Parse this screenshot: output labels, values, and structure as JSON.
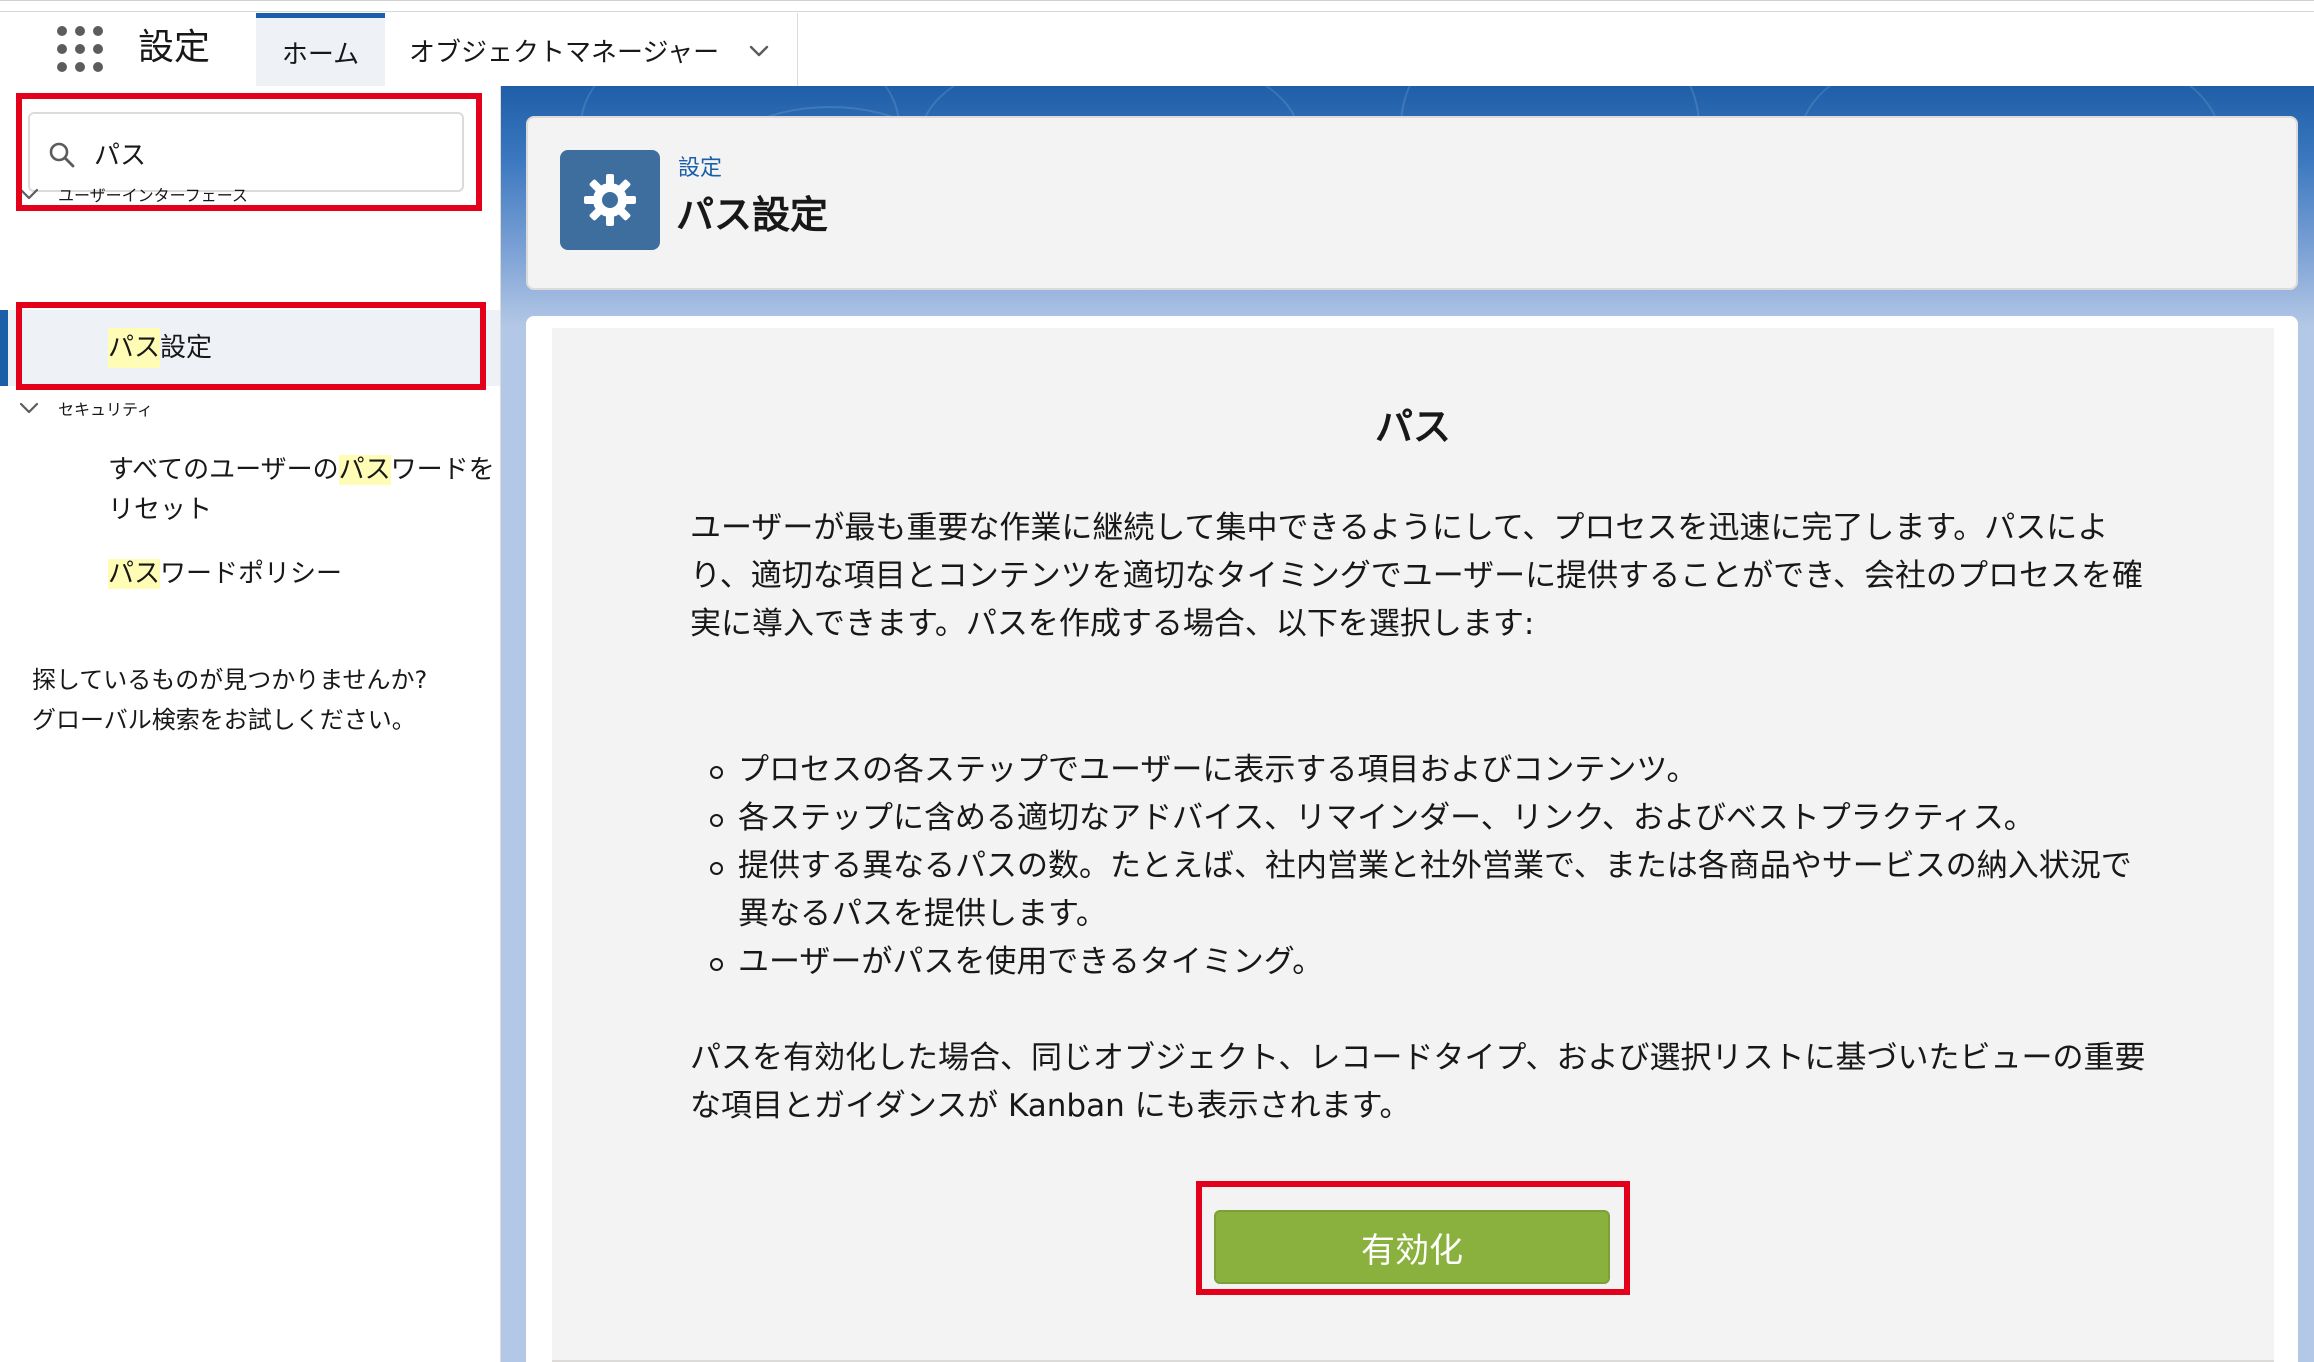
{
  "header": {
    "app_name": "設定",
    "tabs": [
      {
        "label": "ホーム",
        "active": true
      },
      {
        "label": "オブジェクトマネージャー",
        "active": false
      }
    ]
  },
  "sidebar": {
    "search": {
      "value": "パス",
      "placeholder": ""
    },
    "sections": [
      {
        "label": "ユーザーインターフェース",
        "items": [
          {
            "highlight": "パス",
            "rest": "設定",
            "selected": true
          }
        ]
      },
      {
        "label": "セキュリティ",
        "items": [
          {
            "prefix": "すべてのユーザーの",
            "highlight": "パス",
            "rest_line1": "ワードを",
            "rest_line2": "リセット"
          },
          {
            "highlight": "パス",
            "rest": "ワードポリシー"
          }
        ]
      }
    ],
    "help_line1": "探しているものが見つかりませんか?",
    "help_line2": "グローバル検索をお試しください。"
  },
  "page_header": {
    "breadcrumb": "設定",
    "title": "パス設定",
    "icon": "gear-icon"
  },
  "content": {
    "title": "パス",
    "description": "ユーザーが最も重要な作業に継続して集中できるようにして、プロセスを迅速に完了します。パスにより、適切な項目とコンテンツを適切なタイミングでユーザーに提供することができ、会社のプロセスを確実に導入できます。パスを作成する場合、以下を選択します:",
    "bullets": [
      "プロセスの各ステップでユーザーに表示する項目およびコンテンツ。",
      "各ステップに含める適切なアドバイス、リマインダー、リンク、およびベストプラクティス。",
      "提供する異なるパスの数。たとえば、社内営業と社外営業で、または各商品やサービスの納入状況で異なるパスを提供します。",
      "ユーザーがパスを使用できるタイミング。"
    ],
    "description2": "パスを有効化した場合、同じオブジェクト、レコードタイプ、および選択リストに基づいたビューの重要な項目とガイダンスが Kanban にも表示されます。",
    "enable_label": "有効化"
  },
  "colors": {
    "brand": "#1b5fa8",
    "enable_button": "#8ab13e",
    "annotation": "#e3001b",
    "search_highlight": "#fffcb5"
  }
}
